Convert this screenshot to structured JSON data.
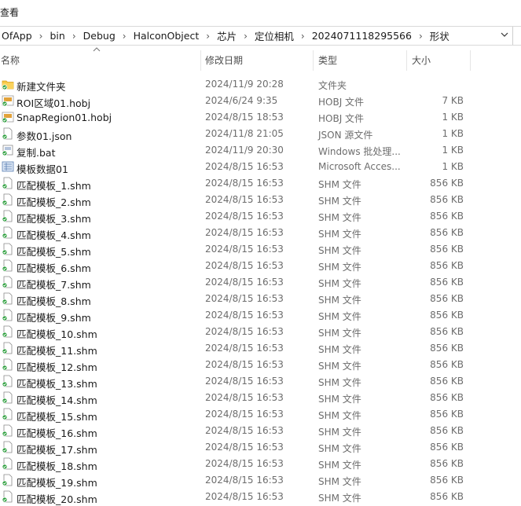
{
  "ribbon": {
    "view_tab": "查看"
  },
  "breadcrumbs": [
    "OfApp",
    "bin",
    "Debug",
    "HalconObject",
    "芯片",
    "定位相机",
    "2024071118295566",
    "形状"
  ],
  "columns": {
    "name": "名称",
    "date": "修改日期",
    "type": "类型",
    "size": "大小"
  },
  "files": [
    {
      "name": "新建文件夹",
      "date": "2024/11/9 20:28",
      "type": "文件夹",
      "size": "",
      "icon": "folder-icon"
    },
    {
      "name": "ROI区域01.hobj",
      "date": "2024/6/24 9:35",
      "type": "HOBJ 文件",
      "size": "7 KB",
      "icon": "hobj-file-icon"
    },
    {
      "name": "SnapRegion01.hobj",
      "date": "2024/8/15 18:53",
      "type": "HOBJ 文件",
      "size": "1 KB",
      "icon": "hobj-file-icon"
    },
    {
      "name": "参数01.json",
      "date": "2024/11/8 21:05",
      "type": "JSON 源文件",
      "size": "1 KB",
      "icon": "json-file-icon"
    },
    {
      "name": "复制.bat",
      "date": "2024/11/9 20:30",
      "type": "Windows 批处理...",
      "size": "1 KB",
      "icon": "bat-file-icon"
    },
    {
      "name": "模板数据01",
      "date": "2024/8/15 16:53",
      "type": "Microsoft Acces...",
      "size": "1 KB",
      "icon": "access-file-icon"
    },
    {
      "name": "匹配模板_1.shm",
      "date": "2024/8/15 16:53",
      "type": "SHM 文件",
      "size": "856 KB",
      "icon": "shm-file-icon"
    },
    {
      "name": "匹配模板_2.shm",
      "date": "2024/8/15 16:53",
      "type": "SHM 文件",
      "size": "856 KB",
      "icon": "shm-file-icon"
    },
    {
      "name": "匹配模板_3.shm",
      "date": "2024/8/15 16:53",
      "type": "SHM 文件",
      "size": "856 KB",
      "icon": "shm-file-icon"
    },
    {
      "name": "匹配模板_4.shm",
      "date": "2024/8/15 16:53",
      "type": "SHM 文件",
      "size": "856 KB",
      "icon": "shm-file-icon"
    },
    {
      "name": "匹配模板_5.shm",
      "date": "2024/8/15 16:53",
      "type": "SHM 文件",
      "size": "856 KB",
      "icon": "shm-file-icon"
    },
    {
      "name": "匹配模板_6.shm",
      "date": "2024/8/15 16:53",
      "type": "SHM 文件",
      "size": "856 KB",
      "icon": "shm-file-icon"
    },
    {
      "name": "匹配模板_7.shm",
      "date": "2024/8/15 16:53",
      "type": "SHM 文件",
      "size": "856 KB",
      "icon": "shm-file-icon"
    },
    {
      "name": "匹配模板_8.shm",
      "date": "2024/8/15 16:53",
      "type": "SHM 文件",
      "size": "856 KB",
      "icon": "shm-file-icon"
    },
    {
      "name": "匹配模板_9.shm",
      "date": "2024/8/15 16:53",
      "type": "SHM 文件",
      "size": "856 KB",
      "icon": "shm-file-icon"
    },
    {
      "name": "匹配模板_10.shm",
      "date": "2024/8/15 16:53",
      "type": "SHM 文件",
      "size": "856 KB",
      "icon": "shm-file-icon"
    },
    {
      "name": "匹配模板_11.shm",
      "date": "2024/8/15 16:53",
      "type": "SHM 文件",
      "size": "856 KB",
      "icon": "shm-file-icon"
    },
    {
      "name": "匹配模板_12.shm",
      "date": "2024/8/15 16:53",
      "type": "SHM 文件",
      "size": "856 KB",
      "icon": "shm-file-icon"
    },
    {
      "name": "匹配模板_13.shm",
      "date": "2024/8/15 16:53",
      "type": "SHM 文件",
      "size": "856 KB",
      "icon": "shm-file-icon"
    },
    {
      "name": "匹配模板_14.shm",
      "date": "2024/8/15 16:53",
      "type": "SHM 文件",
      "size": "856 KB",
      "icon": "shm-file-icon"
    },
    {
      "name": "匹配模板_15.shm",
      "date": "2024/8/15 16:53",
      "type": "SHM 文件",
      "size": "856 KB",
      "icon": "shm-file-icon"
    },
    {
      "name": "匹配模板_16.shm",
      "date": "2024/8/15 16:53",
      "type": "SHM 文件",
      "size": "856 KB",
      "icon": "shm-file-icon"
    },
    {
      "name": "匹配模板_17.shm",
      "date": "2024/8/15 16:53",
      "type": "SHM 文件",
      "size": "856 KB",
      "icon": "shm-file-icon"
    },
    {
      "name": "匹配模板_18.shm",
      "date": "2024/8/15 16:53",
      "type": "SHM 文件",
      "size": "856 KB",
      "icon": "shm-file-icon"
    },
    {
      "name": "匹配模板_19.shm",
      "date": "2024/8/15 16:53",
      "type": "SHM 文件",
      "size": "856 KB",
      "icon": "shm-file-icon"
    },
    {
      "name": "匹配模板_20.shm",
      "date": "2024/8/15 16:53",
      "type": "SHM 文件",
      "size": "856 KB",
      "icon": "shm-file-icon"
    }
  ]
}
